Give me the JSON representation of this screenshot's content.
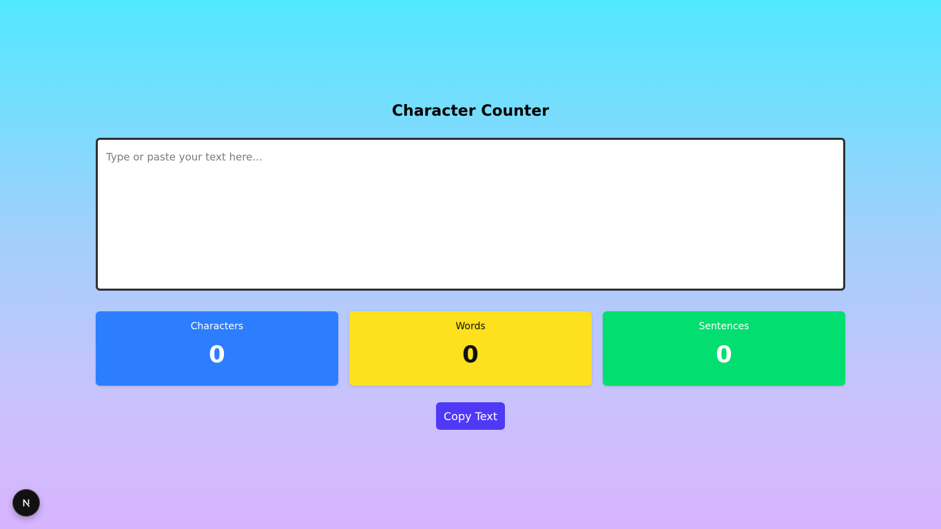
{
  "title": "Character Counter",
  "textarea": {
    "placeholder": "Type or paste your text here...",
    "value": ""
  },
  "stats": [
    {
      "label": "Characters",
      "value": "0",
      "color": "#2c7efe"
    },
    {
      "label": "Words",
      "value": "0",
      "color": "#fde01e"
    },
    {
      "label": "Sentences",
      "value": "0",
      "color": "#02df70"
    }
  ],
  "copy_button": {
    "label": "Copy Text",
    "color": "#4f39f6"
  },
  "dev_badge": {
    "icon": "nextjs-logo-icon"
  }
}
